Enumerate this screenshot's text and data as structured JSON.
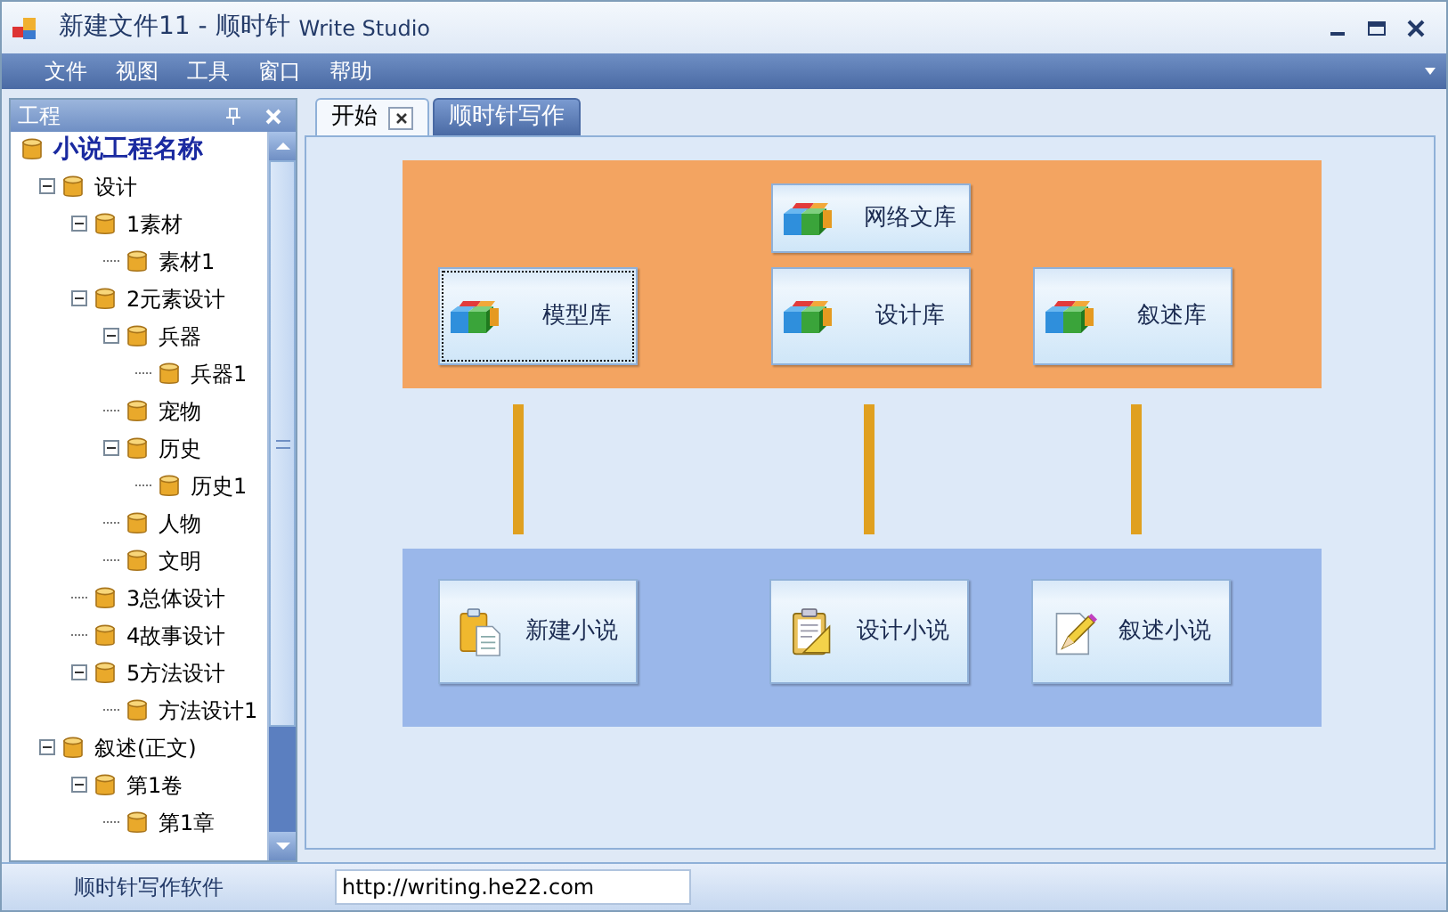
{
  "window": {
    "title": "新建文件11  - 顺时针",
    "title_suffix": "Write Studio"
  },
  "menu": [
    "文件",
    "视图",
    "工具",
    "窗口",
    "帮助"
  ],
  "panel": {
    "title": "工程"
  },
  "tree": {
    "label": "小说工程名称",
    "children": [
      {
        "label": "设计",
        "expanded": true,
        "children": [
          {
            "label": "1素材",
            "expanded": true,
            "children": [
              {
                "label": "素材1"
              }
            ]
          },
          {
            "label": "2元素设计",
            "expanded": true,
            "children": [
              {
                "label": "兵器",
                "expanded": true,
                "children": [
                  {
                    "label": "兵器1"
                  }
                ]
              },
              {
                "label": "宠物"
              },
              {
                "label": "历史",
                "expanded": true,
                "children": [
                  {
                    "label": "历史1"
                  }
                ]
              },
              {
                "label": "人物"
              },
              {
                "label": "文明"
              }
            ]
          },
          {
            "label": "3总体设计"
          },
          {
            "label": "4故事设计"
          },
          {
            "label": "5方法设计",
            "expanded": true,
            "children": [
              {
                "label": "方法设计1"
              }
            ]
          }
        ]
      },
      {
        "label": "叙述(正文)",
        "expanded": true,
        "children": [
          {
            "label": "第1卷",
            "expanded": true,
            "children": [
              {
                "label": "第1章"
              }
            ]
          }
        ]
      }
    ]
  },
  "tabs": [
    {
      "label": "开始",
      "selected": true,
      "closable": true
    },
    {
      "label": "顺时针写作",
      "selected": false,
      "closable": false
    }
  ],
  "libraries": [
    {
      "label": "模型库",
      "focused": true
    },
    {
      "label": "网络文库",
      "focused": false
    },
    {
      "label": "设计库",
      "focused": false
    },
    {
      "label": "叙述库",
      "focused": false
    }
  ],
  "novel_actions": [
    {
      "label": "新建小说",
      "kind": "new"
    },
    {
      "label": "设计小说",
      "kind": "design"
    },
    {
      "label": "叙述小说",
      "kind": "write"
    }
  ],
  "status_bar": {
    "label": "顺时针写作软件",
    "url": "http://writing.he22.com"
  }
}
